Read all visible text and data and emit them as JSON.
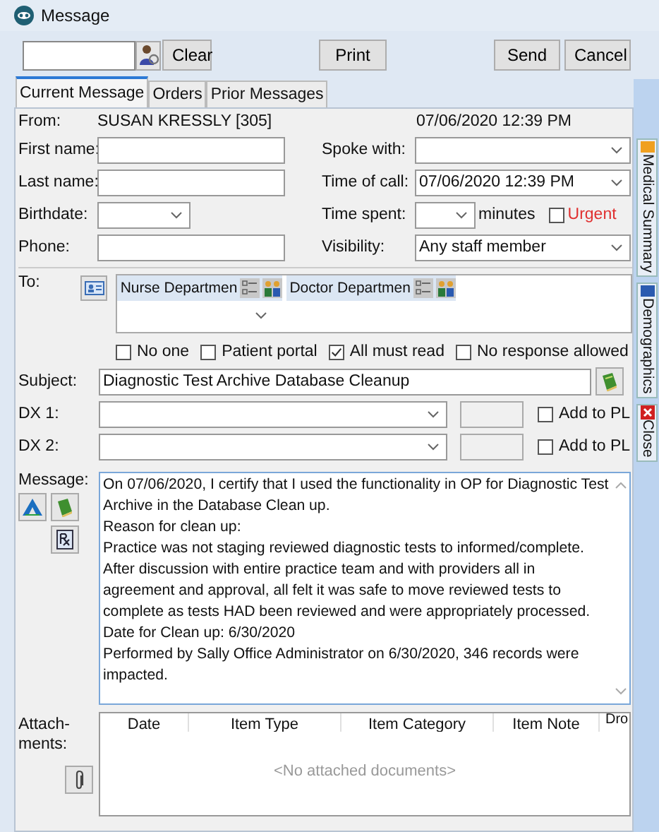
{
  "window": {
    "title": "Message"
  },
  "toolbar": {
    "buttons": [
      {
        "kind": "clear",
        "label": "Clear"
      },
      {
        "kind": "print",
        "label": "Print"
      },
      {
        "kind": "send",
        "label": "Send"
      },
      {
        "kind": "cancel",
        "label": "Cancel"
      }
    ]
  },
  "tabs": [
    {
      "label": "Current Message",
      "selected": true
    },
    {
      "label": "Orders",
      "selected": false
    },
    {
      "label": "Prior Messages",
      "selected": false
    }
  ],
  "from": {
    "label": "From:",
    "value": "SUSAN KRESSLY [305]",
    "date": "07/06/2020 12:39 PM"
  },
  "left_fields": [
    {
      "label": "First name:",
      "kind": "text"
    },
    {
      "label": "Last name:",
      "kind": "text"
    },
    {
      "label": "Birthdate:",
      "kind": "dropdown"
    },
    {
      "label": "Phone:",
      "kind": "text"
    }
  ],
  "right_fields": [
    {
      "label": "Spoke with:",
      "kind": "dropdown"
    },
    {
      "label": "Time of call:",
      "kind": "dropdown",
      "value": "07/06/2020 12:39 PM"
    },
    {
      "label": "Time spent:",
      "kind": "time",
      "unit": "minutes",
      "urgent": {
        "label": "Urgent",
        "checked": false
      }
    },
    {
      "label": "Visibility:",
      "kind": "dropdown",
      "value": "Any staff member"
    }
  ],
  "to": {
    "label": "To:",
    "recipients": [
      "Nurse Departmen",
      "Doctor Departmen"
    ]
  },
  "options": [
    {
      "label": "No one",
      "checked": false
    },
    {
      "label": "Patient portal",
      "checked": false
    },
    {
      "label": "All must read",
      "checked": true
    },
    {
      "label": "No response allowed",
      "checked": false
    }
  ],
  "subject": {
    "label": "Subject:",
    "value": "Diagnostic Test Archive Database Cleanup"
  },
  "dx": [
    {
      "label": "DX 1:",
      "add_label": "Add to PL",
      "checked": false
    },
    {
      "label": "DX 2:",
      "add_label": "Add to PL",
      "checked": false
    }
  ],
  "message": {
    "label": "Message:",
    "paragraphs": [
      "On 07/06/2020, I certify that I used the functionality in OP for Diagnostic Test Archive in the Database Clean up.",
      "Reason for clean up:",
      "Practice was not staging reviewed diagnostic tests to informed/complete.",
      "After discussion with entire practice team and with providers all in agreement and approval, all felt it was safe to move reviewed tests to complete as tests HAD been reviewed and were appropriately processed.",
      "Date for Clean up: 6/30/2020",
      "Performed by Sally Office Administrator on 6/30/2020, 346 records were impacted."
    ]
  },
  "attachments": {
    "label_lines": [
      "Attach-",
      "ments:"
    ],
    "columns": [
      "Date",
      "Item Type",
      "Item Category",
      "Item Note"
    ],
    "column_5": "Dro",
    "empty_text": "<No attached documents>"
  },
  "side_tabs": [
    {
      "kind": "summary",
      "label": "Medical Summary"
    },
    {
      "kind": "demographics",
      "label": "Demographics"
    },
    {
      "kind": "close",
      "label": "Close"
    }
  ]
}
